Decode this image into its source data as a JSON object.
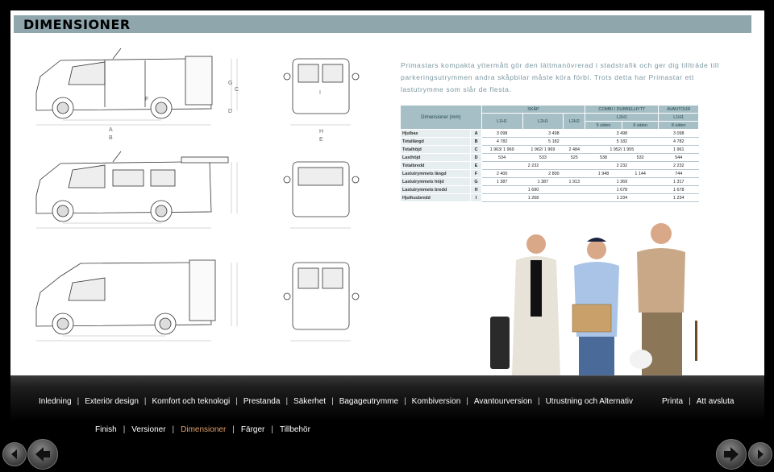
{
  "header": {
    "title": "DIMENSIONER"
  },
  "intro": "Primastars kompakta yttermått gör den lättmanövrerad i stadstrafik och ger dig tillträde till parkeringsutrymmen andra skåpbilar måste köra förbi. Trots detta har Primastar ett lastutrymme som slår de flesta.",
  "drawing_labels": {
    "A": "A",
    "B": "B",
    "C": "C",
    "D": "D",
    "E": "E",
    "F": "F",
    "G": "G",
    "H": "H",
    "I": "I"
  },
  "table": {
    "label_header": "Dimensioner (mm)",
    "groups": [
      "SKÅP",
      "COMBI / DUBBELHYTT",
      "AVANTOUR"
    ],
    "variants": [
      "L1H1",
      "L2H1",
      "L2H2",
      "L2H1",
      "L1H1"
    ],
    "seats": [
      "5 säten",
      "9 säten",
      "8 säten"
    ],
    "rows": [
      {
        "label": "Hjulbas",
        "code": "A",
        "cells": [
          "3 098",
          "3 498",
          "3 498",
          "3 098"
        ]
      },
      {
        "label": "Totallängd",
        "code": "B",
        "cells": [
          "4 782",
          "5 182",
          "5 182",
          "4 782"
        ]
      },
      {
        "label": "Totalhöjd",
        "code": "C",
        "cells": [
          "1 963/ 1 969",
          "1 962/ 1 969",
          "2 484",
          "1 952/ 1 955",
          "1 961"
        ]
      },
      {
        "label": "Lasthöjd",
        "code": "D",
        "cells": [
          "534",
          "533",
          "525",
          "538",
          "532",
          "544"
        ]
      },
      {
        "label": "Totalbredd",
        "code": "E",
        "cells": [
          "2 232",
          "2 232",
          "2 232"
        ]
      },
      {
        "label": "Lastutrymmets längd",
        "code": "F",
        "cells": [
          "2 400",
          "2 800",
          "1 948",
          "1 144",
          "744"
        ]
      },
      {
        "label": "Lastutrymmets höjd",
        "code": "G",
        "cells": [
          "1 387",
          "1 387",
          "1 913",
          "1 369",
          "1 317"
        ]
      },
      {
        "label": "Lastutrymmets bredd",
        "code": "H",
        "cells": [
          "1 690",
          "1 678",
          "1 678"
        ]
      },
      {
        "label": "Hjulhusbredd",
        "code": "I",
        "cells": [
          "1 268",
          "1 234",
          "1 234"
        ]
      }
    ]
  },
  "nav": {
    "items": [
      "Inledning",
      "Exteriör design",
      "Komfort och teknologi",
      "Prestanda",
      "Säkerhet",
      "Bagageutrymme",
      "Kombiversion",
      "Avantourversion",
      "Utrustning och Alternativ"
    ],
    "right_items": [
      "Printa",
      "Att avsluta"
    ]
  },
  "subnav": {
    "items": [
      "Finish",
      "Versioner",
      "Dimensioner",
      "Färger",
      "Tillbehör"
    ],
    "active": "Dimensioner"
  },
  "colors": {
    "accent": "#8fa6ad",
    "active_link": "#e0a16d",
    "intro_text": "#7a97a1"
  }
}
